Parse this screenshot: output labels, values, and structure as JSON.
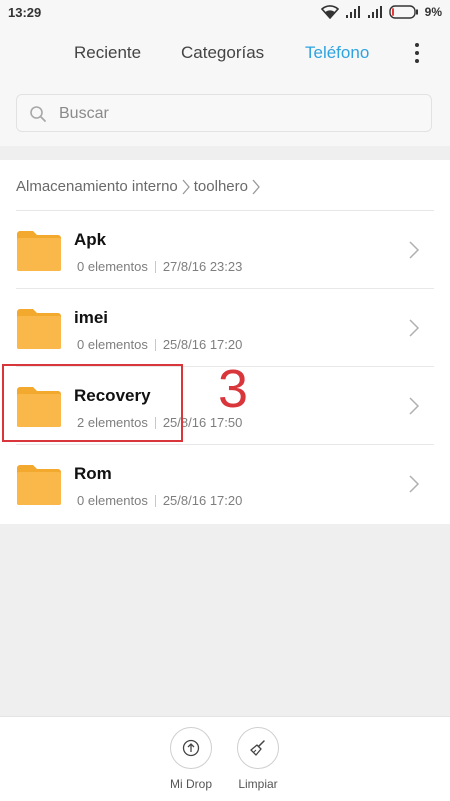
{
  "status_bar": {
    "time": "13:29",
    "battery_percent": "9%",
    "battery_level": 0.09,
    "icons": [
      "wifi-icon",
      "signal-icon",
      "signal-icon",
      "battery-icon"
    ]
  },
  "tabs": [
    {
      "label": "Reciente",
      "active": false
    },
    {
      "label": "Categorías",
      "active": false
    },
    {
      "label": "Teléfono",
      "active": true
    }
  ],
  "search": {
    "placeholder": "Buscar",
    "value": ""
  },
  "breadcrumb": [
    "Almacenamiento interno",
    "toolhero"
  ],
  "files": [
    {
      "name": "Apk",
      "count": "0 elementos",
      "date": "27/8/16 23:23"
    },
    {
      "name": "imei",
      "count": "0 elementos",
      "date": "25/8/16 17:20"
    },
    {
      "name": "Recovery",
      "count": "2 elementos",
      "date": "25/8/16 17:50"
    },
    {
      "name": "Rom",
      "count": "0 elementos",
      "date": "25/8/16 17:20"
    }
  ],
  "annotation": {
    "number": "3",
    "highlighted_item": "Recovery"
  },
  "bottom_actions": [
    {
      "label": "Mi Drop",
      "icon": "upload-icon"
    },
    {
      "label": "Limpiar",
      "icon": "broom-icon"
    }
  ],
  "colors": {
    "accent": "#2ea3e0",
    "folder": "#fbb84a",
    "annotation": "#d9363c"
  }
}
